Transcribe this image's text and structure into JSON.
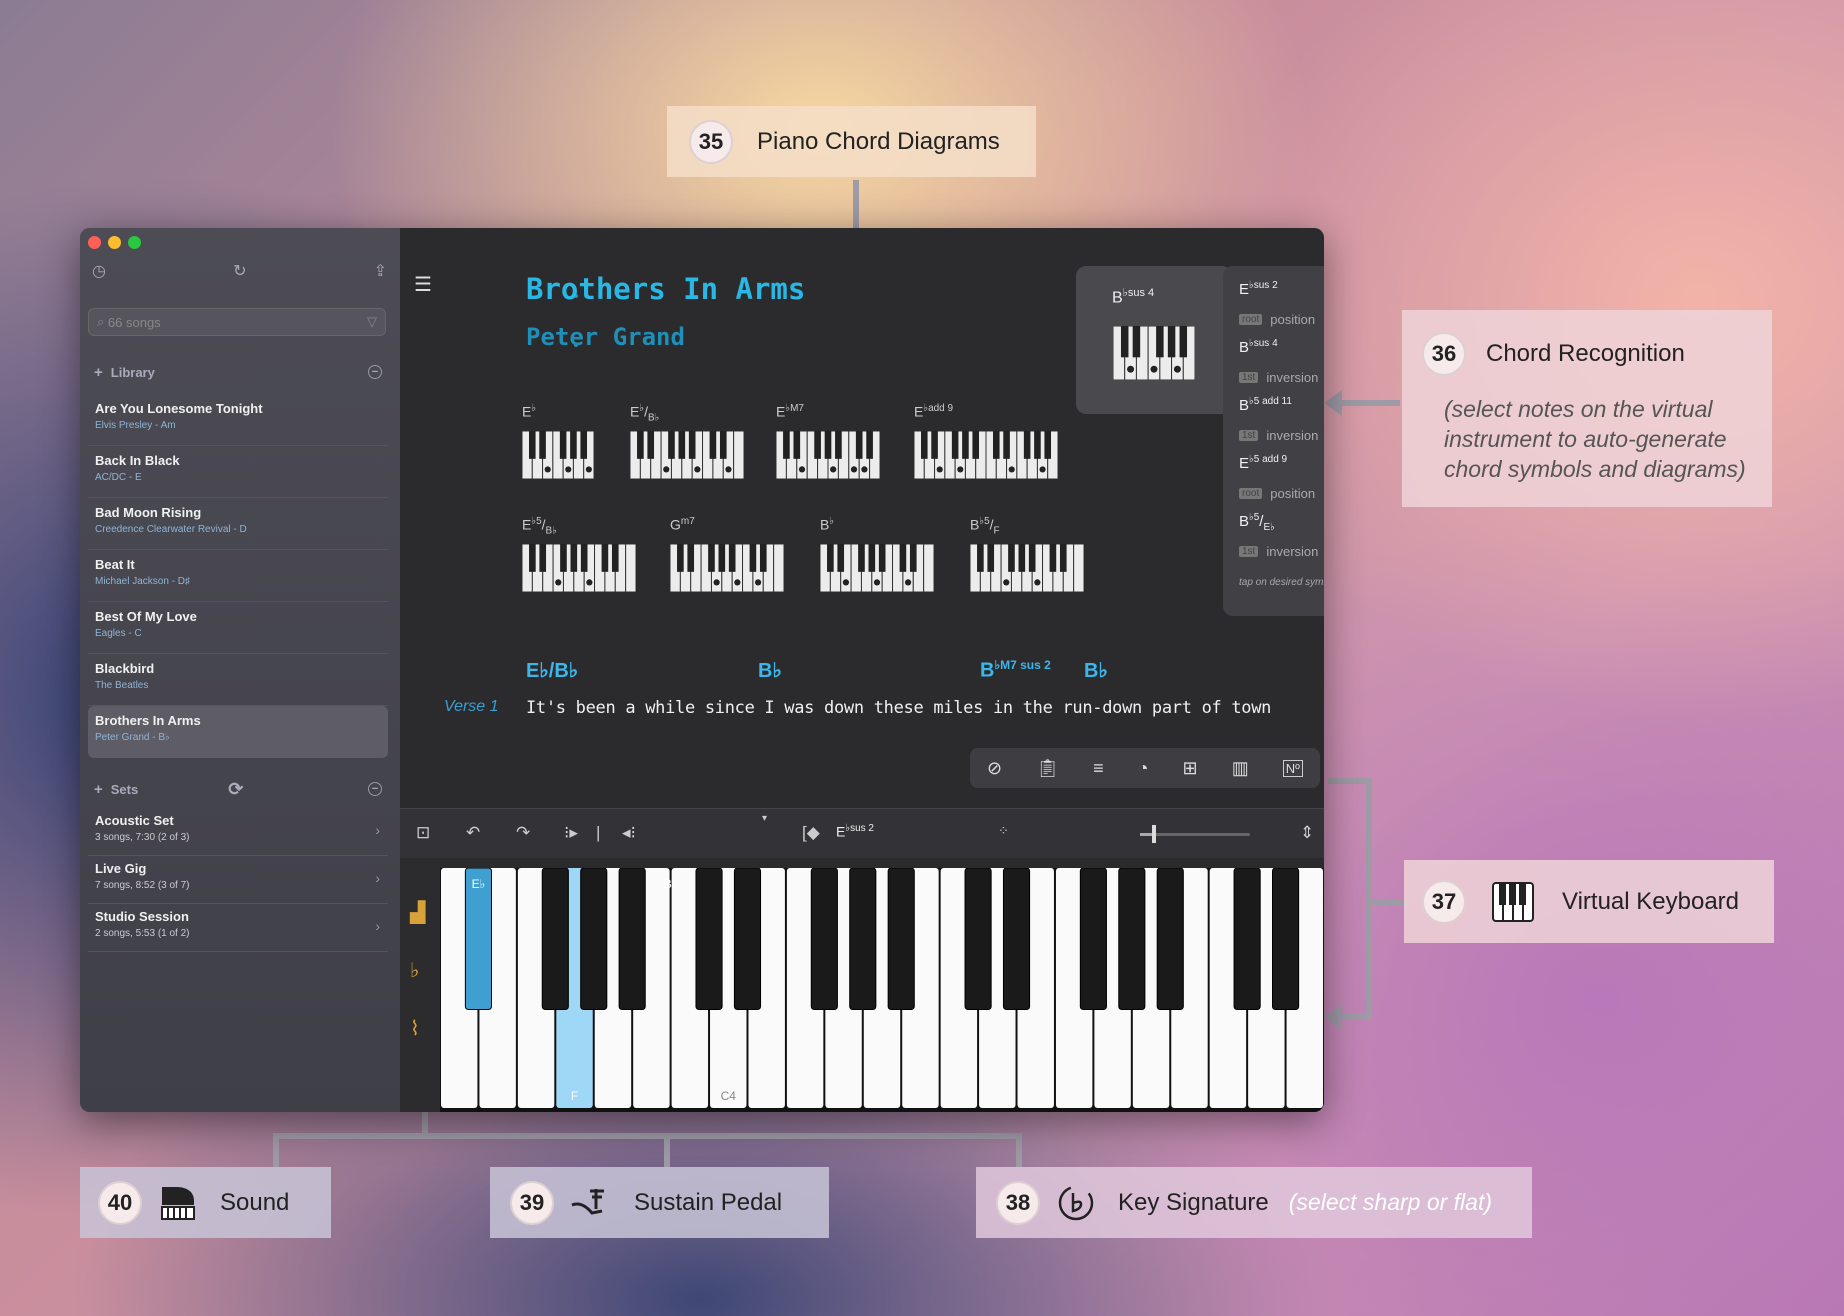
{
  "callouts": {
    "c35": {
      "num": "35",
      "title": "Piano Chord Diagrams"
    },
    "c36": {
      "num": "36",
      "title": "Chord Recognition",
      "note": "(select notes on the virtual instrument to auto-generate chord symbols and diagrams)"
    },
    "c37": {
      "num": "37",
      "title": "Virtual Keyboard"
    },
    "c38": {
      "num": "38",
      "title": "Key Signature",
      "note": "(select sharp or flat)"
    },
    "c39": {
      "num": "39",
      "title": "Sustain Pedal"
    },
    "c40": {
      "num": "40",
      "title": "Sound"
    }
  },
  "sidebar": {
    "search_placeholder": "66 songs",
    "library_label": "Library",
    "songs": [
      {
        "title": "Are You Lonesome Tonight",
        "sub": "Elvis Presley - Am"
      },
      {
        "title": "Back In Black",
        "sub": "AC/DC - E"
      },
      {
        "title": "Bad Moon Rising",
        "sub": "Creedence Clearwater Revival - D"
      },
      {
        "title": "Beat It",
        "sub": "Michael Jackson - D♯"
      },
      {
        "title": "Best Of My Love",
        "sub": "Eagles - C"
      },
      {
        "title": "Blackbird",
        "sub": "The Beatles"
      },
      {
        "title": "Brothers In Arms",
        "sub": "Peter Grand - B♭"
      }
    ],
    "sets_label": "Sets",
    "sets": [
      {
        "title": "Acoustic Set",
        "sub": "3 songs, 7:30 (2 of 3)"
      },
      {
        "title": "Live Gig",
        "sub": "7 songs, 8:52 (3 of 7)"
      },
      {
        "title": "Studio Session",
        "sub": "2 songs, 5:53 (1 of 2)"
      }
    ]
  },
  "song": {
    "title": "Brothers In Arms",
    "artist": "Peter Grand"
  },
  "chords": {
    "c1": {
      "root": "E",
      "acc": "♭",
      "ext": "",
      "bass": ""
    },
    "c2": {
      "root": "E",
      "acc": "♭",
      "ext": "",
      "bass": "B♭"
    },
    "c3": {
      "root": "E",
      "acc": "♭",
      "ext": "M7",
      "bass": ""
    },
    "c4": {
      "root": "E",
      "acc": "♭",
      "ext": "add 9",
      "bass": ""
    },
    "c5": {
      "root": "E",
      "acc": "♭",
      "ext": "5",
      "bass": "B♭"
    },
    "c6": {
      "root": "G",
      "acc": "",
      "ext": "m7",
      "bass": ""
    },
    "c7": {
      "root": "B",
      "acc": "♭",
      "ext": "",
      "bass": ""
    },
    "c8": {
      "root": "B",
      "acc": "♭",
      "ext": "5",
      "bass": "F"
    }
  },
  "popover": {
    "root": "B",
    "acc": "♭",
    "ext": "sus 4"
  },
  "recognition": {
    "items": [
      {
        "root": "E",
        "acc": "♭",
        "ext": "sus 2",
        "tag": "root",
        "desc": "position"
      },
      {
        "root": "B",
        "acc": "♭",
        "ext": "sus 4",
        "tag": "1st",
        "desc": "inversion"
      },
      {
        "root": "B",
        "acc": "♭",
        "ext": "5 add 11",
        "tag": "1st",
        "desc": "inversion"
      },
      {
        "root": "E",
        "acc": "♭",
        "ext": "5 add 9",
        "tag": "root",
        "desc": "position"
      },
      {
        "root": "B",
        "acc": "♭",
        "ext": "5",
        "bass": "E♭",
        "tag": "1st",
        "desc": "inversion"
      }
    ],
    "hint": "tap on desired symbol"
  },
  "lyrics": {
    "verse_label": "Verse 1",
    "line": "It's been a while since I was down these miles in the run-down part of town",
    "chord1": "E♭/B♭",
    "chord2": "B♭",
    "chord3_root": "B",
    "chord3_acc": "♭",
    "chord3_ext": "M7 sus 2",
    "chord4": "B♭"
  },
  "kbtoolbar": {
    "chord_root": "E",
    "chord_acc": "♭",
    "chord_ext": "sus 2"
  },
  "keyboard": {
    "white_count": 23,
    "label_f": "F",
    "label_c4": "C4",
    "label_eb": "E♭",
    "label_bb": "B♭"
  },
  "colors": {
    "accent": "#29b8e6",
    "highlight_key": "#9fd7f7",
    "highlight_black": "#3e9fd0"
  }
}
